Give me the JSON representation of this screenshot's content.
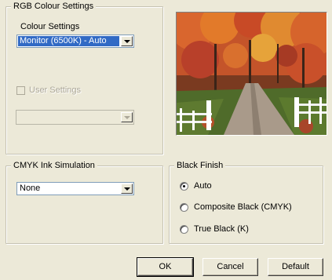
{
  "rgb_group": {
    "legend": "RGB Colour Settings",
    "colour_settings_label": "Colour Settings",
    "colour_settings_value": "Monitor (6500K) - Auto",
    "user_settings_label": "User Settings",
    "user_settings_checked": false,
    "user_settings_value": ""
  },
  "cmyk_group": {
    "legend": "CMYK Ink Simulation",
    "value": "None"
  },
  "black_group": {
    "legend": "Black Finish",
    "options": [
      {
        "label": "Auto",
        "checked": true
      },
      {
        "label": "Composite Black (CMYK)",
        "checked": false
      },
      {
        "label": "True Black (K)",
        "checked": false
      }
    ]
  },
  "buttons": {
    "ok": "OK",
    "cancel": "Cancel",
    "default": "Default"
  },
  "preview": {
    "description_icon": "autumn-lane-photo-icon"
  },
  "colors": {
    "dialog_bg": "#ece9d8",
    "selection": "#316ac5",
    "disabled_text": "#aca899"
  }
}
